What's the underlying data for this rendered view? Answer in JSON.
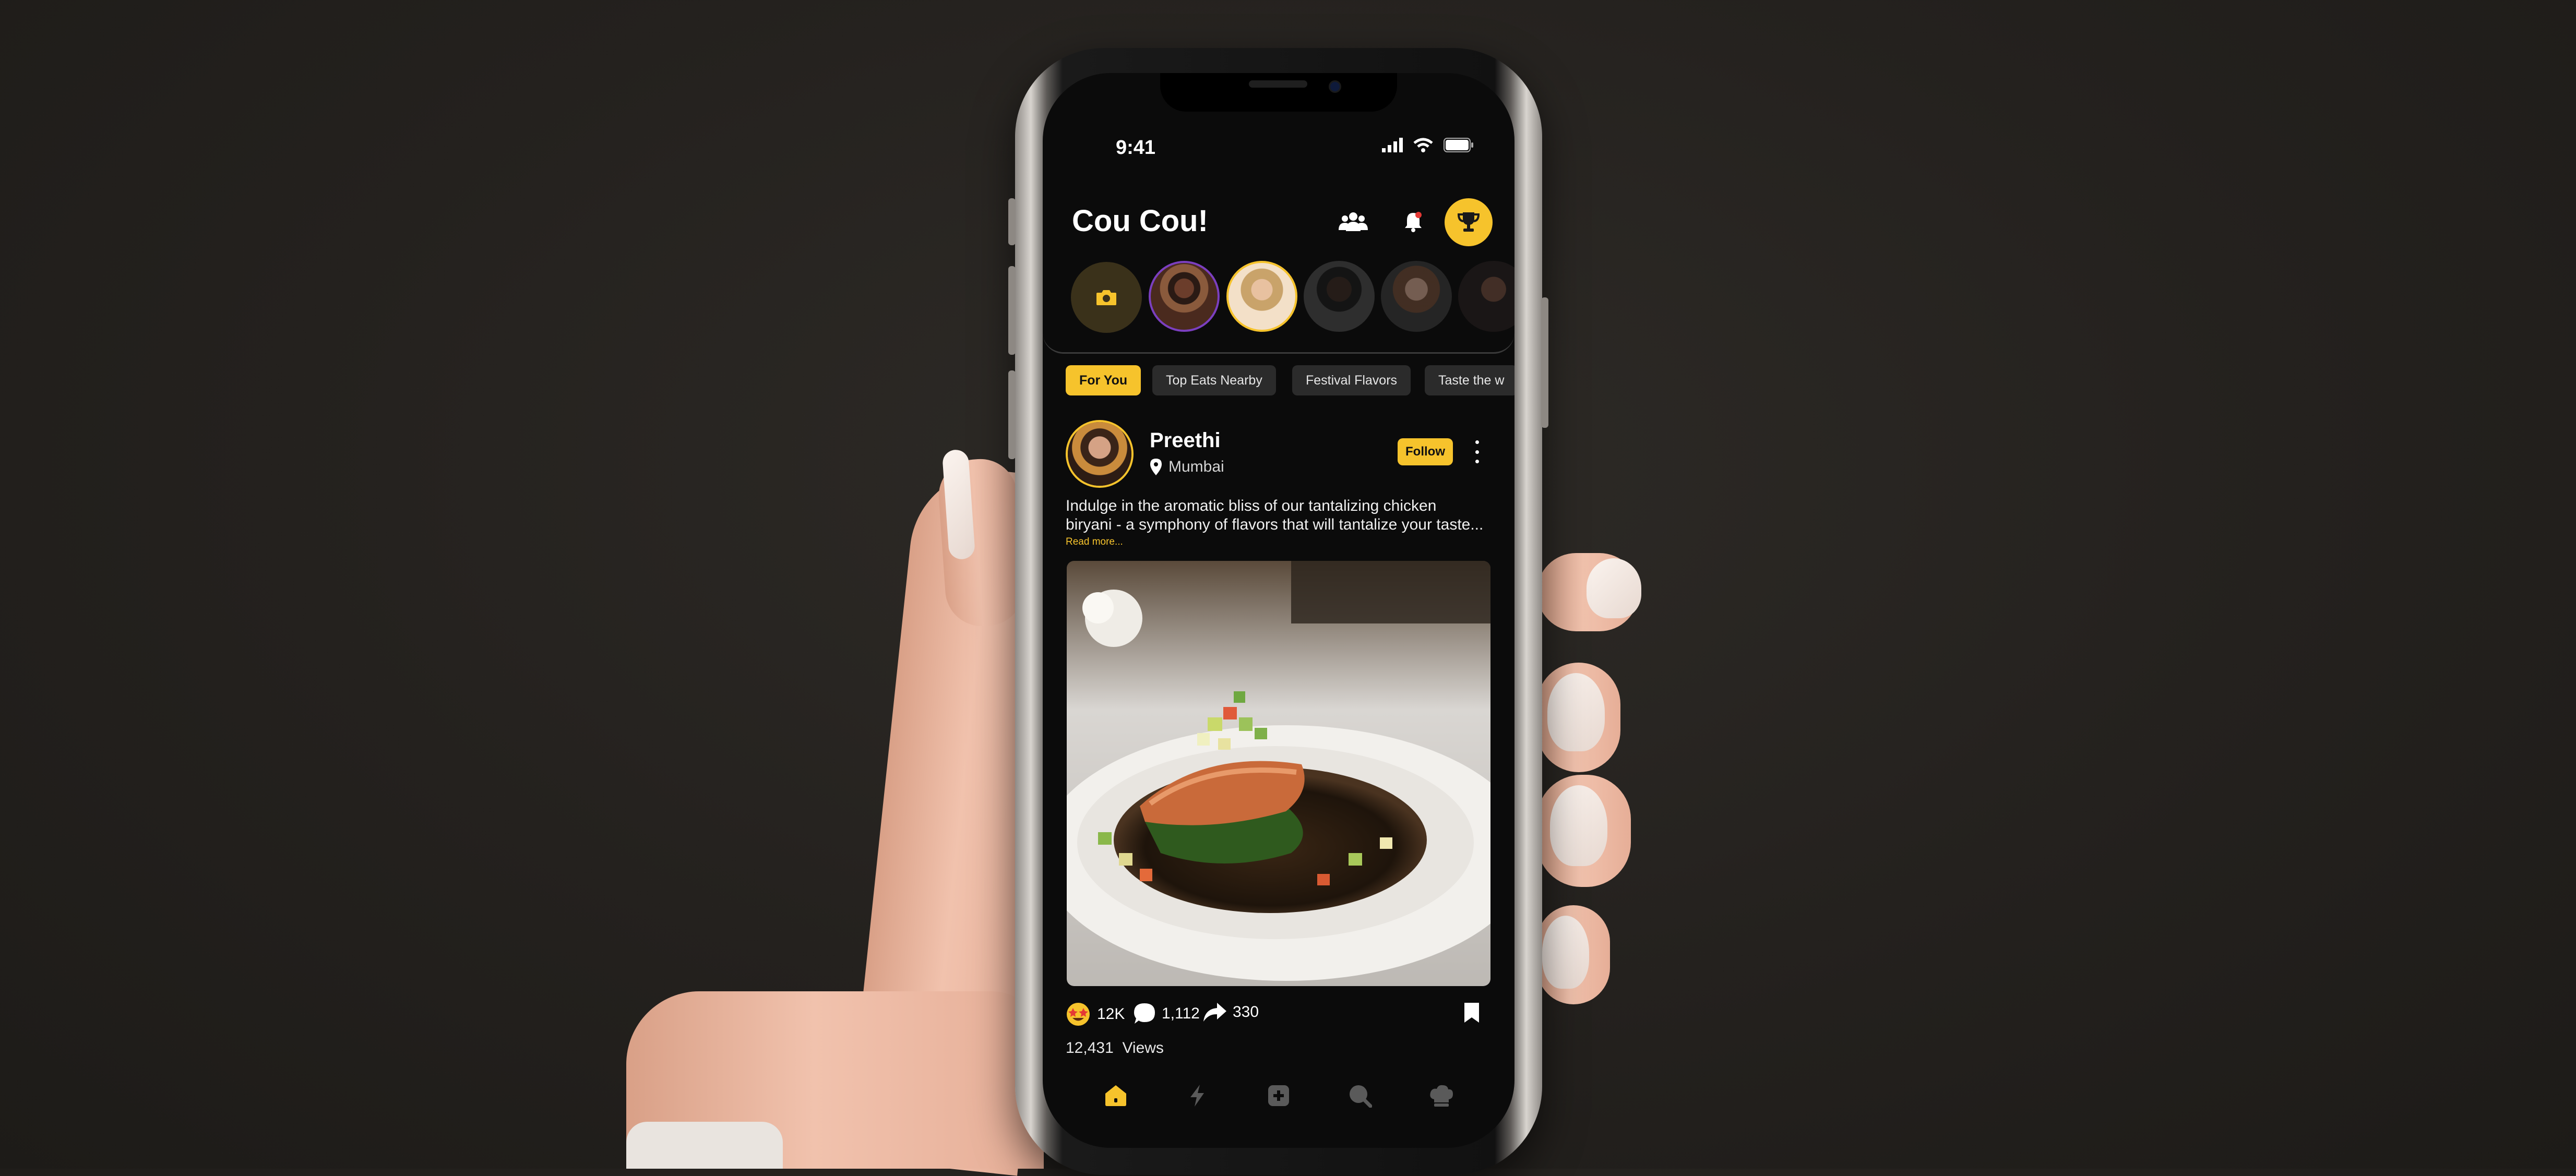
{
  "status_bar": {
    "time": "9:41"
  },
  "header": {
    "title": "Cou Cou!"
  },
  "categories": [
    {
      "label": "For You",
      "active": true
    },
    {
      "label": "Top Eats Nearby",
      "active": false
    },
    {
      "label": "Festival Flavors",
      "active": false
    },
    {
      "label": "Taste the w",
      "active": false
    }
  ],
  "post": {
    "user_name": "Preethi",
    "location": "Mumbai",
    "follow_label": "Follow",
    "caption_line1": "Indulge in the aromatic bliss of our tantalizing chicken",
    "caption_line2": "biryani - a symphony of flavors that will tantalize your taste...",
    "read_more": "Read more...",
    "reactions": "12K",
    "comments": "1,112",
    "shares": "330",
    "views_count": "12,431",
    "views_label": "Views"
  },
  "colors": {
    "accent": "#f6c32c",
    "screen_bg": "#0b0b0b",
    "chip_bg": "#2b2b2b"
  },
  "icons": {
    "header": [
      "users-icon",
      "bell-icon",
      "trophy-icon"
    ],
    "nav": [
      "home-icon",
      "bolt-icon",
      "add-icon",
      "search-icon",
      "chef-hat-icon"
    ]
  }
}
